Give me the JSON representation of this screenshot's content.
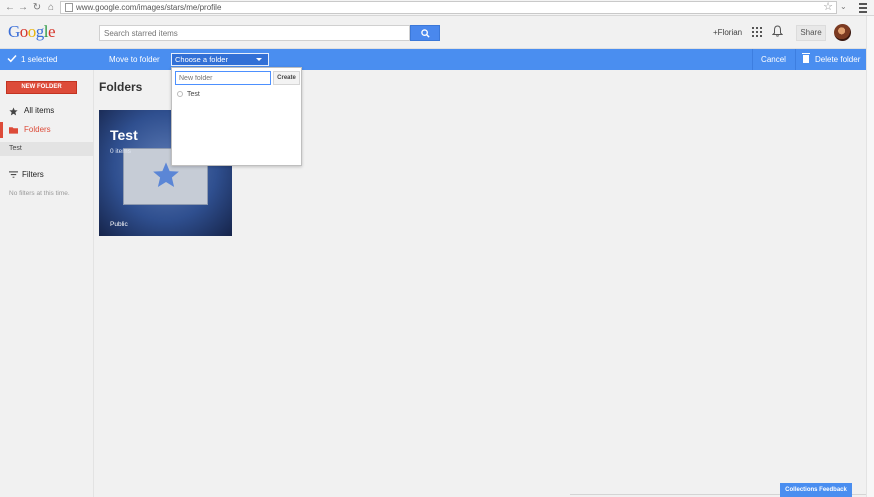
{
  "browser": {
    "url": "www.google.com/images/stars/me/profile",
    "back_icon": "back-arrow-icon",
    "forward_icon": "forward-arrow-icon",
    "reload_icon": "reload-icon",
    "home_icon": "home-icon"
  },
  "header": {
    "logo": [
      "G",
      "o",
      "o",
      "g",
      "l",
      "e"
    ],
    "search_placeholder": "Search starred items",
    "user_link": "+Florian",
    "share_label": "Share"
  },
  "action_bar": {
    "selected_label": "1 selected",
    "move_to_folder_label": "Move to folder",
    "choose_folder_value": "Choose a folder",
    "cancel_label": "Cancel",
    "delete_folder_label": "Delete folder",
    "bar_color": "#4a8ef0"
  },
  "dropdown": {
    "new_folder_placeholder": "New folder",
    "create_label": "Create",
    "folders": [
      {
        "label": "Test"
      }
    ]
  },
  "sidebar": {
    "new_folder_label": "NEW FOLDER",
    "all_items_label": "All items",
    "folders_label": "Folders",
    "active_sub_item": "Test",
    "filters_label": "Filters",
    "no_filters_text": "No filters at this time.",
    "accent_color": "#dd4b39"
  },
  "main": {
    "page_title": "Folders",
    "card": {
      "title": "Test",
      "count": "0 items",
      "visibility": "Public"
    }
  },
  "footer": {
    "feedback_label": "Collections Feedback"
  }
}
